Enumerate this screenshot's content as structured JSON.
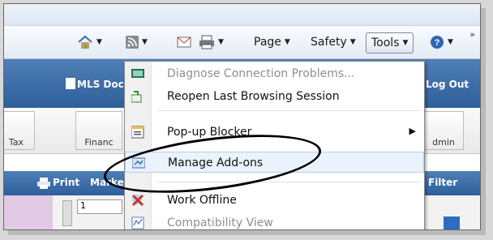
{
  "toolbar": {
    "page_label": "Page",
    "safety_label": "Safety",
    "tools_label": "Tools",
    "help_icon": "help-icon",
    "more_chevron": "»"
  },
  "app": {
    "header_doc": "MLS Doc",
    "logout": "Log Out",
    "tiles": [
      "Tax",
      "Financ",
      "dmin"
    ],
    "print": "Print",
    "market": "Marke",
    "filter": "Filter",
    "row_value": "1"
  },
  "menu": {
    "items": [
      {
        "label": "Diagnose Connection Problems...",
        "disabled": true
      },
      {
        "label": "Reopen Last Browsing Session",
        "disabled": false
      },
      {
        "label": "Pop-up Blocker",
        "disabled": false
      },
      {
        "label": "Manage Add-ons",
        "disabled": false
      },
      {
        "label": "Work Offline",
        "disabled": false
      },
      {
        "label": "Compatibility View",
        "disabled": true
      }
    ]
  },
  "colors": {
    "accent_blue": "#2e5f99",
    "menu_highlight": "#eaf2fb"
  }
}
